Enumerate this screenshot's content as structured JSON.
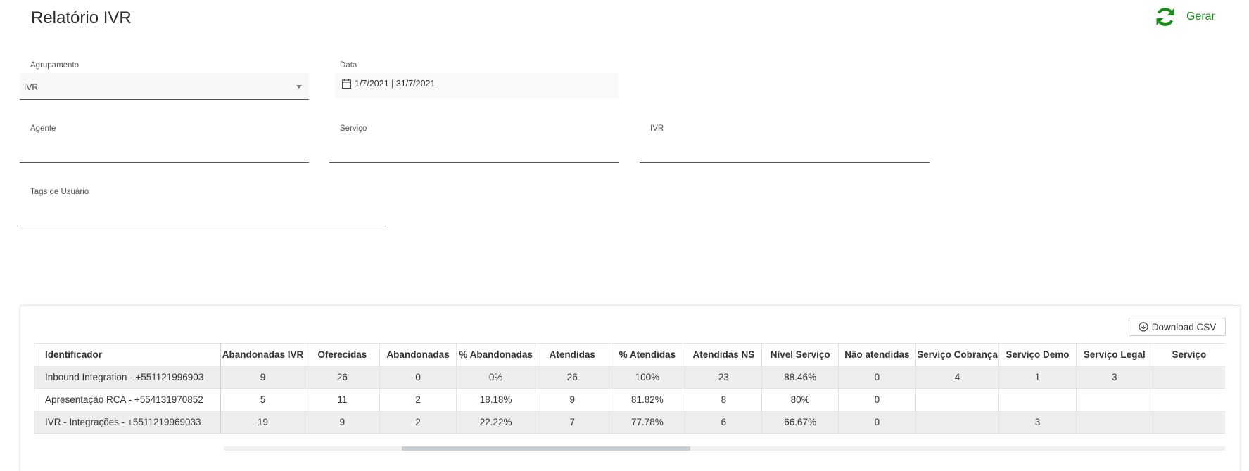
{
  "page": {
    "title": "Relatório IVR"
  },
  "header": {
    "generate_label": "Gerar",
    "generate_icon": "refresh-icon",
    "accent": "#1a8c1a"
  },
  "filters": {
    "agrupamento": {
      "label": "Agrupamento",
      "value": "IVR"
    },
    "data": {
      "label": "Data",
      "value": "1/7/2021 | 31/7/2021"
    },
    "agente": {
      "label": "Agente",
      "value": ""
    },
    "servico": {
      "label": "Serviço",
      "value": ""
    },
    "ivr": {
      "label": "IVR",
      "value": ""
    },
    "tags": {
      "label": "Tags de Usuário",
      "value": ""
    }
  },
  "report": {
    "download_label": "Download CSV",
    "columns": [
      "Identificador",
      "Abandonadas IVR",
      "Oferecidas",
      "Abandonadas",
      "% Abandonadas",
      "Atendidas",
      "% Atendidas",
      "Atendidas NS",
      "Nível Serviço",
      "Não atendidas",
      "Serviço Cobrança",
      "Serviço Demo",
      "Serviço Legal",
      "Serviço"
    ],
    "rows": [
      [
        "Inbound Integration - +551121996903",
        "9",
        "26",
        "0",
        "0%",
        "26",
        "100%",
        "23",
        "88.46%",
        "0",
        "4",
        "1",
        "3",
        ""
      ],
      [
        "Apresentação RCA - +554131970852",
        "5",
        "11",
        "2",
        "18.18%",
        "9",
        "81.82%",
        "8",
        "80%",
        "0",
        "",
        "",
        "",
        ""
      ],
      [
        "IVR - Integrações - +5511219969033",
        "19",
        "9",
        "2",
        "22.22%",
        "7",
        "77.78%",
        "6",
        "66.67%",
        "0",
        "",
        "3",
        "",
        ""
      ]
    ],
    "scroll_position": 0.25
  }
}
